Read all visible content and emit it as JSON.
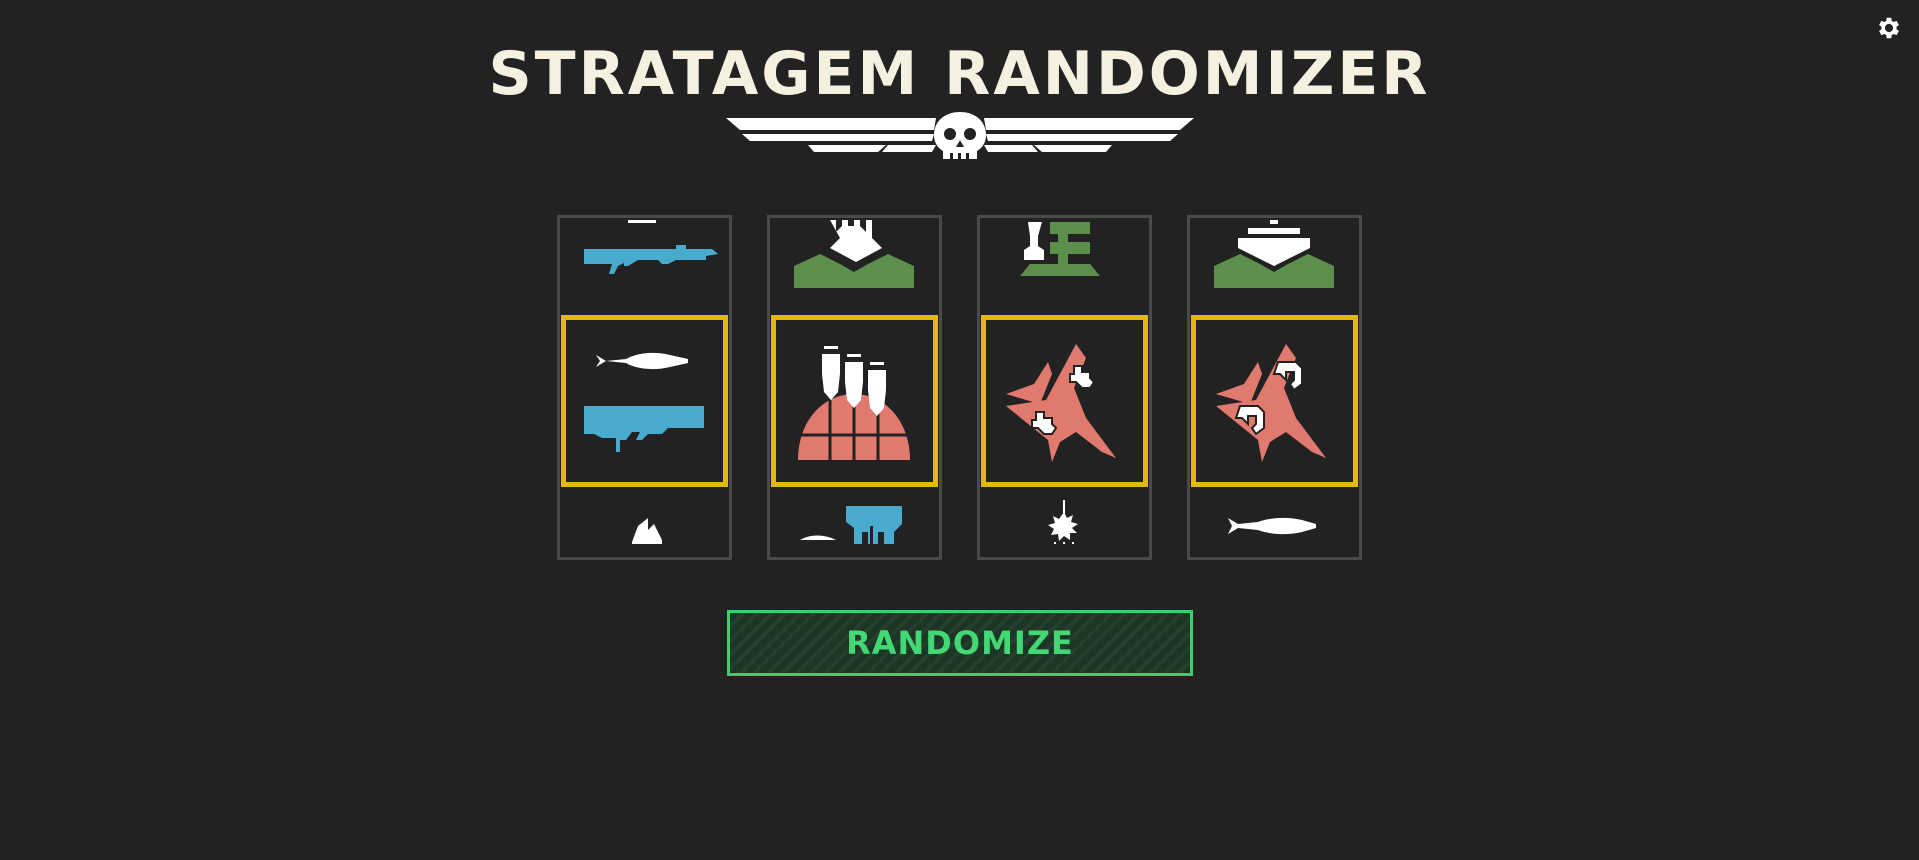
{
  "page": {
    "title": "STRATAGEM RANDOMIZER",
    "randomize_label": "RANDOMIZE"
  },
  "icons": {
    "settings": "gear-icon",
    "emblem": "skull-wings-emblem"
  },
  "colors": {
    "background": "#222222",
    "title": "#f4f1e1",
    "highlight": "#e3b90c",
    "button_accent": "#43d873",
    "weapon_blue": "#48aacc",
    "orbital_red": "#e07a6e",
    "defense_green": "#5d8f4c"
  },
  "reels": [
    {
      "top": "rifle-icon",
      "selected": "recoilless-rifle-icon",
      "bottom": "flame-icon"
    },
    {
      "top": "bunker-icon",
      "selected": "orbital-barrage-icon",
      "bottom": "backpack-icon"
    },
    {
      "top": "turret-icon",
      "selected": "eagle-strike-icon",
      "bottom": "orbital-laser-icon"
    },
    {
      "top": "shield-emplacement-icon",
      "selected": "eagle-rearm-icon",
      "bottom": "missile-icon"
    }
  ]
}
